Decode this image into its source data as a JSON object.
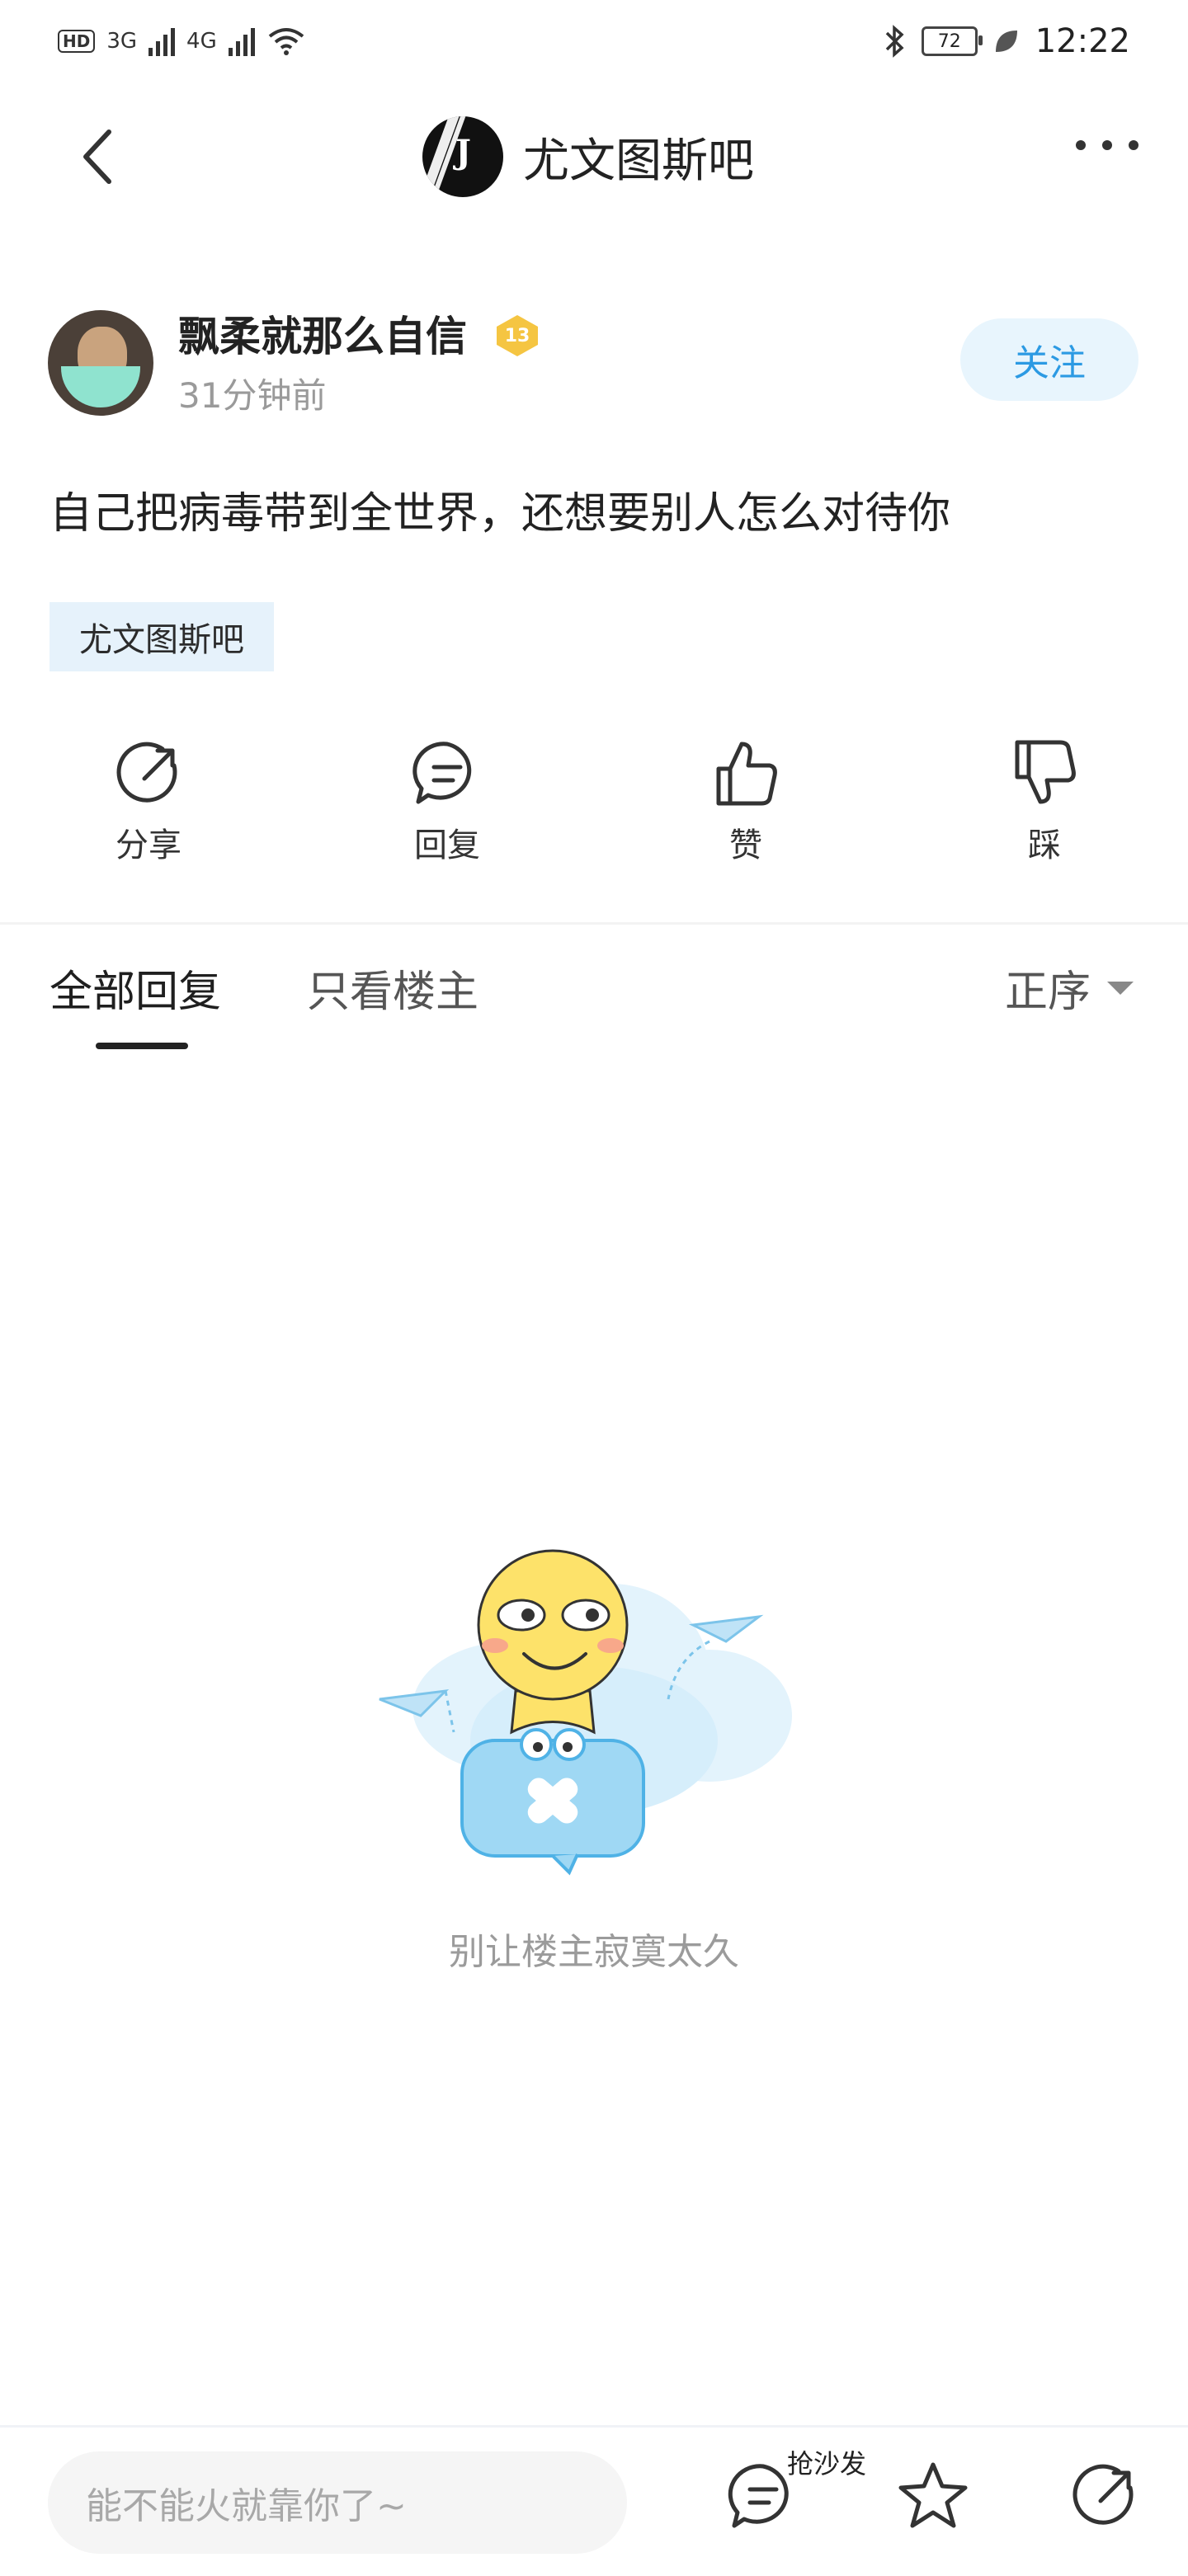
{
  "status_bar": {
    "hd_badge": "HD",
    "network_1": "3G",
    "network_2": "4G",
    "battery": "72",
    "time": "12:22"
  },
  "header": {
    "forum_name": "尤文图斯吧"
  },
  "post": {
    "author_name": "飘柔就那么自信",
    "author_level": "13",
    "time": "31分钟前",
    "follow_label": "关注",
    "content": "自己把病毒带到全世界，还想要别人怎么对待你",
    "tag": "尤文图斯吧"
  },
  "actions": [
    {
      "label": "分享",
      "icon": "share-icon"
    },
    {
      "label": "回复",
      "icon": "reply-icon"
    },
    {
      "label": "赞",
      "icon": "thumbs-up-icon"
    },
    {
      "label": "踩",
      "icon": "thumbs-down-icon"
    }
  ],
  "reply_tabs": {
    "all": "全部回复",
    "owner_only": "只看楼主",
    "sort": "正序"
  },
  "empty_state": {
    "text": "别让楼主寂寞太久"
  },
  "bottom_bar": {
    "input_placeholder": "能不能火就靠你了~",
    "sofa_label": "抢沙发"
  },
  "colors": {
    "accent": "#2c9ae3",
    "tag_bg": "#e6f2fb",
    "level_badge": "#f5c542"
  }
}
